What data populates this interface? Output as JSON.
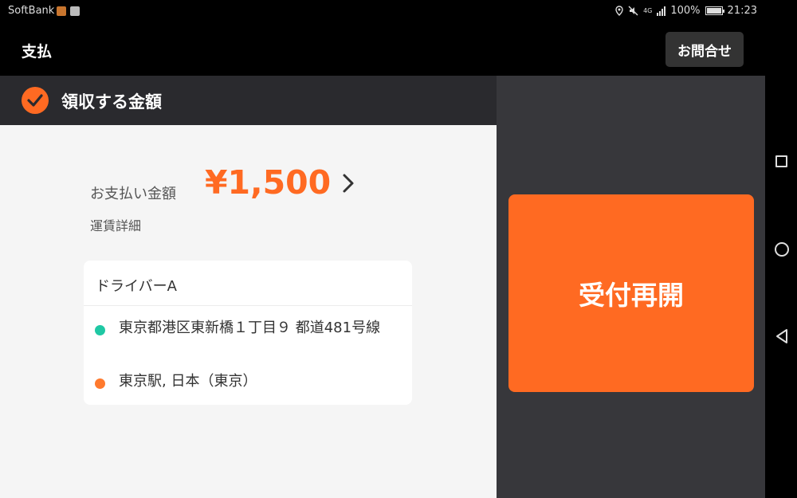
{
  "status_bar": {
    "carrier": "SoftBank",
    "network": "4G",
    "battery": "100%",
    "battery_level": 1.0,
    "time": "21:23"
  },
  "header": {
    "title": "支払",
    "contact_label": "お問合せ"
  },
  "section": {
    "title": "領収する金額",
    "icon": "check-circle-icon"
  },
  "payment": {
    "amount_label": "お支払い金額",
    "amount": "¥1,500",
    "fare_details_label": "運賃詳細"
  },
  "trip": {
    "driver": "ドライバーA",
    "origin": "東京都港区東新橋１丁目９ 都道481号線",
    "destination": "東京駅, 日本（東京）"
  },
  "actions": {
    "resume_label": "受付再開"
  },
  "colors": {
    "accent": "#ff6a22",
    "origin_dot": "#1fc8a4",
    "destination_dot": "#ff7a2e",
    "panel_dark": "#37373b",
    "header_dark": "#2a2a2e"
  }
}
